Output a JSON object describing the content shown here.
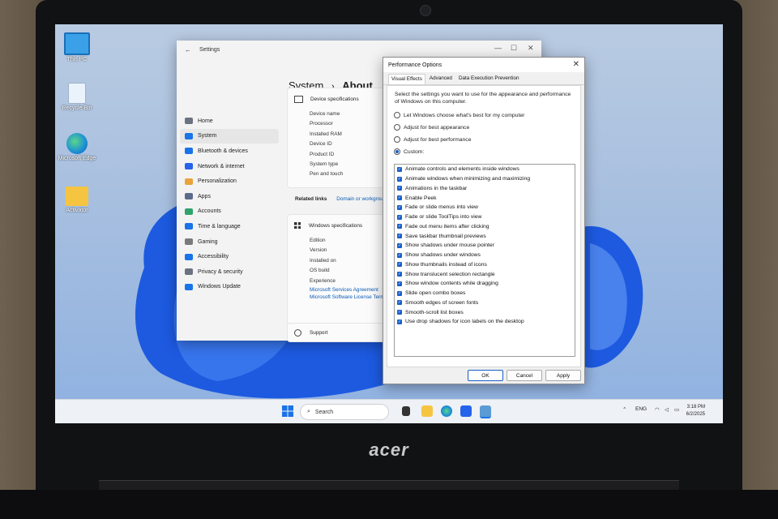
{
  "desktop_icons": [
    {
      "label": "This PC",
      "icon": "monitor-icon"
    },
    {
      "label": "Recycle Bin",
      "icon": "recycle-bin-icon"
    },
    {
      "label": "Microsoft Edge",
      "icon": "edge-icon"
    },
    {
      "label": "Activator",
      "icon": "folder-icon"
    }
  ],
  "settings": {
    "window_title": "Settings",
    "breadcrumb_parent": "System",
    "breadcrumb_sep": "›",
    "breadcrumb_current": "About",
    "nav": [
      {
        "label": "Home",
        "icon": "home-icon",
        "color": "#6b7280"
      },
      {
        "label": "System",
        "icon": "system-icon",
        "color": "#1a73e8"
      },
      {
        "label": "Bluetooth & devices",
        "icon": "bluetooth-icon",
        "color": "#1a73e8"
      },
      {
        "label": "Network & internet",
        "icon": "network-icon",
        "color": "#2563eb"
      },
      {
        "label": "Personalization",
        "icon": "brush-icon",
        "color": "#e8a33c"
      },
      {
        "label": "Apps",
        "icon": "apps-icon",
        "color": "#5b6b8a"
      },
      {
        "label": "Accounts",
        "icon": "accounts-icon",
        "color": "#2fa36b"
      },
      {
        "label": "Time & language",
        "icon": "globe-icon",
        "color": "#1a73e8"
      },
      {
        "label": "Gaming",
        "icon": "gaming-icon",
        "color": "#7a7a7a"
      },
      {
        "label": "Accessibility",
        "icon": "accessibility-icon",
        "color": "#1a73e8"
      },
      {
        "label": "Privacy & security",
        "icon": "shield-icon",
        "color": "#6b7280"
      },
      {
        "label": "Windows Update",
        "icon": "update-icon",
        "color": "#1a73e8"
      }
    ],
    "device_specs_title": "Device specifications",
    "device_spec_rows": [
      "Device name",
      "Processor",
      "Installed RAM",
      "Device ID",
      "Product ID",
      "System type",
      "Pen and touch"
    ],
    "related_links_label": "Related links",
    "related_link": "Domain or workgroup",
    "windows_specs_title": "Windows specifications",
    "windows_spec_rows": [
      "Edition",
      "Version",
      "Installed on",
      "OS build",
      "Experience"
    ],
    "windows_spec_links": [
      "Microsoft Services Agreement",
      "Microsoft Software License Terms"
    ],
    "support_label": "Support"
  },
  "perf": {
    "title": "Performance Options",
    "close_glyph": "✕",
    "tabs": [
      "Visual Effects",
      "Advanced",
      "Data Execution Prevention"
    ],
    "description": "Select the settings you want to use for the appearance and performance of Windows on this computer.",
    "radios": [
      {
        "label": "Let Windows choose what's best for my computer",
        "selected": false
      },
      {
        "label": "Adjust for best appearance",
        "selected": false
      },
      {
        "label": "Adjust for best performance",
        "selected": false
      },
      {
        "label": "Custom:",
        "selected": true
      }
    ],
    "options": [
      "Animate controls and elements inside windows",
      "Animate windows when minimizing and maximizing",
      "Animations in the taskbar",
      "Enable Peek",
      "Fade or slide menus into view",
      "Fade or slide ToolTips into view",
      "Fade out menu items after clicking",
      "Save taskbar thumbnail previews",
      "Show shadows under mouse pointer",
      "Show shadows under windows",
      "Show thumbnails instead of icons",
      "Show translucent selection rectangle",
      "Show window contents while dragging",
      "Slide open combo boxes",
      "Smooth edges of screen fonts",
      "Smooth-scroll list boxes",
      "Use drop shadows for icon labels on the desktop"
    ],
    "ok_label": "OK",
    "cancel_label": "Cancel",
    "apply_label": "Apply"
  },
  "taskbar": {
    "search_placeholder": "Search",
    "language": "ENG",
    "time": "3:18 PM",
    "date": "6/2/2025"
  },
  "laptop": {
    "brand": "acer"
  },
  "colors": {
    "accent": "#1a5fc9",
    "wallpaper_bloom": "#1f5fe0"
  }
}
